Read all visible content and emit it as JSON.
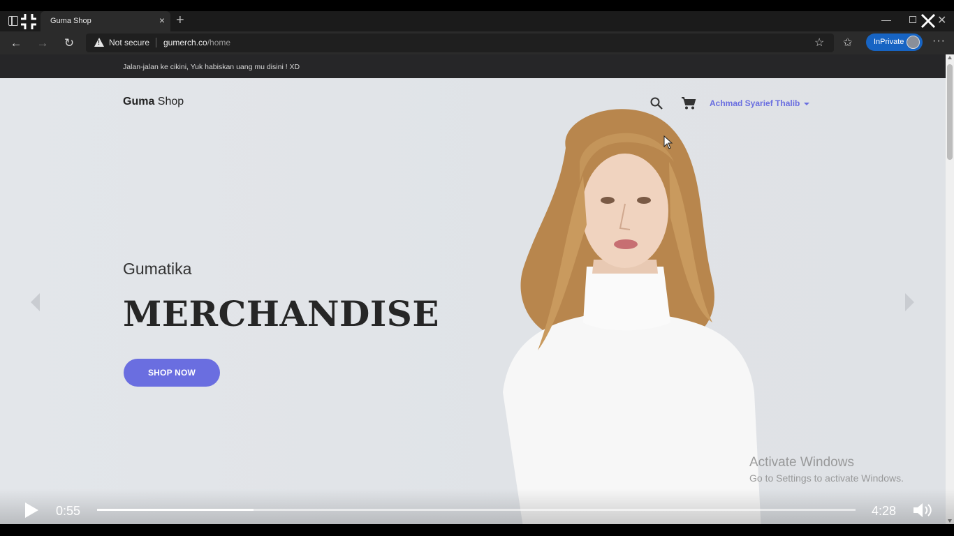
{
  "browser": {
    "tab_title": "Guma Shop",
    "tab_close": "×",
    "new_tab": "+",
    "security_label": "Not secure",
    "url_host": "gumerch.co",
    "url_path": "/home",
    "inprivate_label": "InPrivate",
    "more_label": "···",
    "win_min": "—",
    "win_close": "✕"
  },
  "page": {
    "announcement": "Jalan-jalan ke cikini, Yuk habiskan uang mu disini ! XD",
    "brand_bold": "Guma",
    "brand_rest": " Shop",
    "user_name": "Achmad Syarief Thalib",
    "hero_subtitle": "Gumatika",
    "hero_title": "MERCHANDISE",
    "shop_button": "SHOP NOW"
  },
  "watermark": {
    "title": "Activate Windows",
    "subtitle": "Go to Settings to activate Windows."
  },
  "video": {
    "current_time": "0:55",
    "total_time": "4:28",
    "progress": 0.206
  },
  "colors": {
    "accent": "#6a6ee0",
    "inprivate": "#1764c3",
    "announcement_bg": "#262628"
  },
  "icons": [
    "tab-actions-icon",
    "exit-fullscreen-icon",
    "back-icon",
    "forward-icon",
    "refresh-icon",
    "warning-icon",
    "add-favorite-icon",
    "favorites-icon",
    "search-icon",
    "cart-icon",
    "play-icon",
    "volume-icon",
    "close-icon"
  ]
}
